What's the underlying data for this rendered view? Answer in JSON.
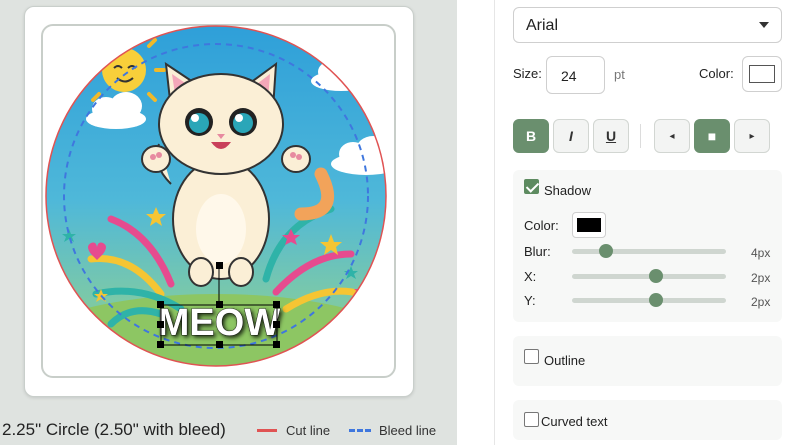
{
  "canvas": {
    "overlay_text": "MEOW",
    "caption": "2.25\" Circle (2.50\" with bleed)",
    "legend": {
      "cut_line": "Cut line",
      "bleed_line": "Bleed line"
    },
    "colors": {
      "cut_line": "#e05353",
      "bleed_line": "#3f77de",
      "background": "#dfe3e0"
    }
  },
  "panel": {
    "font": {
      "selected": "Arial",
      "caret": "chevron-down-icon"
    },
    "size": {
      "label": "Size:",
      "value": "24",
      "unit": "pt"
    },
    "color": {
      "label": "Color:",
      "value": "#ffffff"
    },
    "format_buttons": {
      "bold": "B",
      "italic": "I",
      "underline": "U",
      "bold_active": true
    },
    "align_buttons": {
      "left": "◂",
      "center": "■",
      "right": "▸",
      "active": "center"
    },
    "shadow": {
      "label": "Shadow",
      "checked": true,
      "color_label": "Color:",
      "color": "#000000",
      "blur_label": "Blur:",
      "blur_value": "4px",
      "blur": 4,
      "x_label": "X:",
      "x_value": "2px",
      "x": 2,
      "y_label": "Y:",
      "y_value": "2px",
      "y": 2
    },
    "outline": {
      "label": "Outline",
      "checked": false
    },
    "curved_text": {
      "label": "Curved text",
      "checked": false
    },
    "accent": "#6a8f6e"
  }
}
